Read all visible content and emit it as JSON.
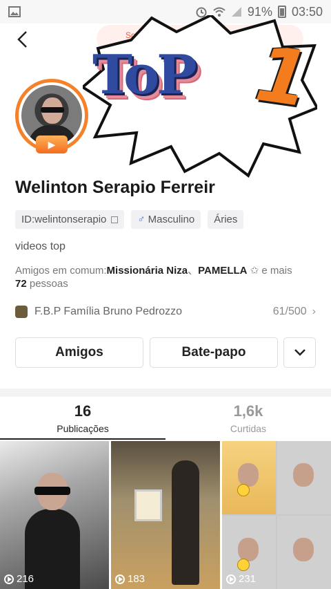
{
  "status_bar": {
    "battery": "91%",
    "time": "03:50"
  },
  "header": {
    "request_label": "Solici"
  },
  "profile": {
    "name": "Welinton Serapio Ferreir",
    "tags": {
      "id": "ID:welintonserapio",
      "gender": "Masculino",
      "gender_symbol": "♂",
      "sign": "Áries"
    },
    "bio": "videos top",
    "mutual": {
      "prefix": "Amigos em comum:",
      "friend1": "Missionária Niza",
      "sep": "、",
      "friend2": "PAMELLA",
      "star": "✩",
      "suffix": " e mais ",
      "count": "72",
      "suffix2": " pessoas"
    },
    "small_label": "S"
  },
  "overlay": {
    "top_text": "ToP",
    "one_text": "1"
  },
  "family": {
    "name": "F.B.P Família Bruno Pedrozzo",
    "count": "61/500",
    "chevron": "›"
  },
  "actions": {
    "friends_label": "Amigos",
    "chat_label": "Bate-papo",
    "more_symbol": "⌄"
  },
  "tabs": [
    {
      "count": "16",
      "label": "Publicações",
      "active": true
    },
    {
      "count": "1,6k",
      "label": "Curtidas",
      "active": false
    }
  ],
  "videos": [
    {
      "views": "216"
    },
    {
      "views": "183"
    },
    {
      "views": "231"
    }
  ],
  "colors": {
    "accent": "#f5822a",
    "burst_text": "#2f4a9e",
    "one": "#f37c1f"
  }
}
